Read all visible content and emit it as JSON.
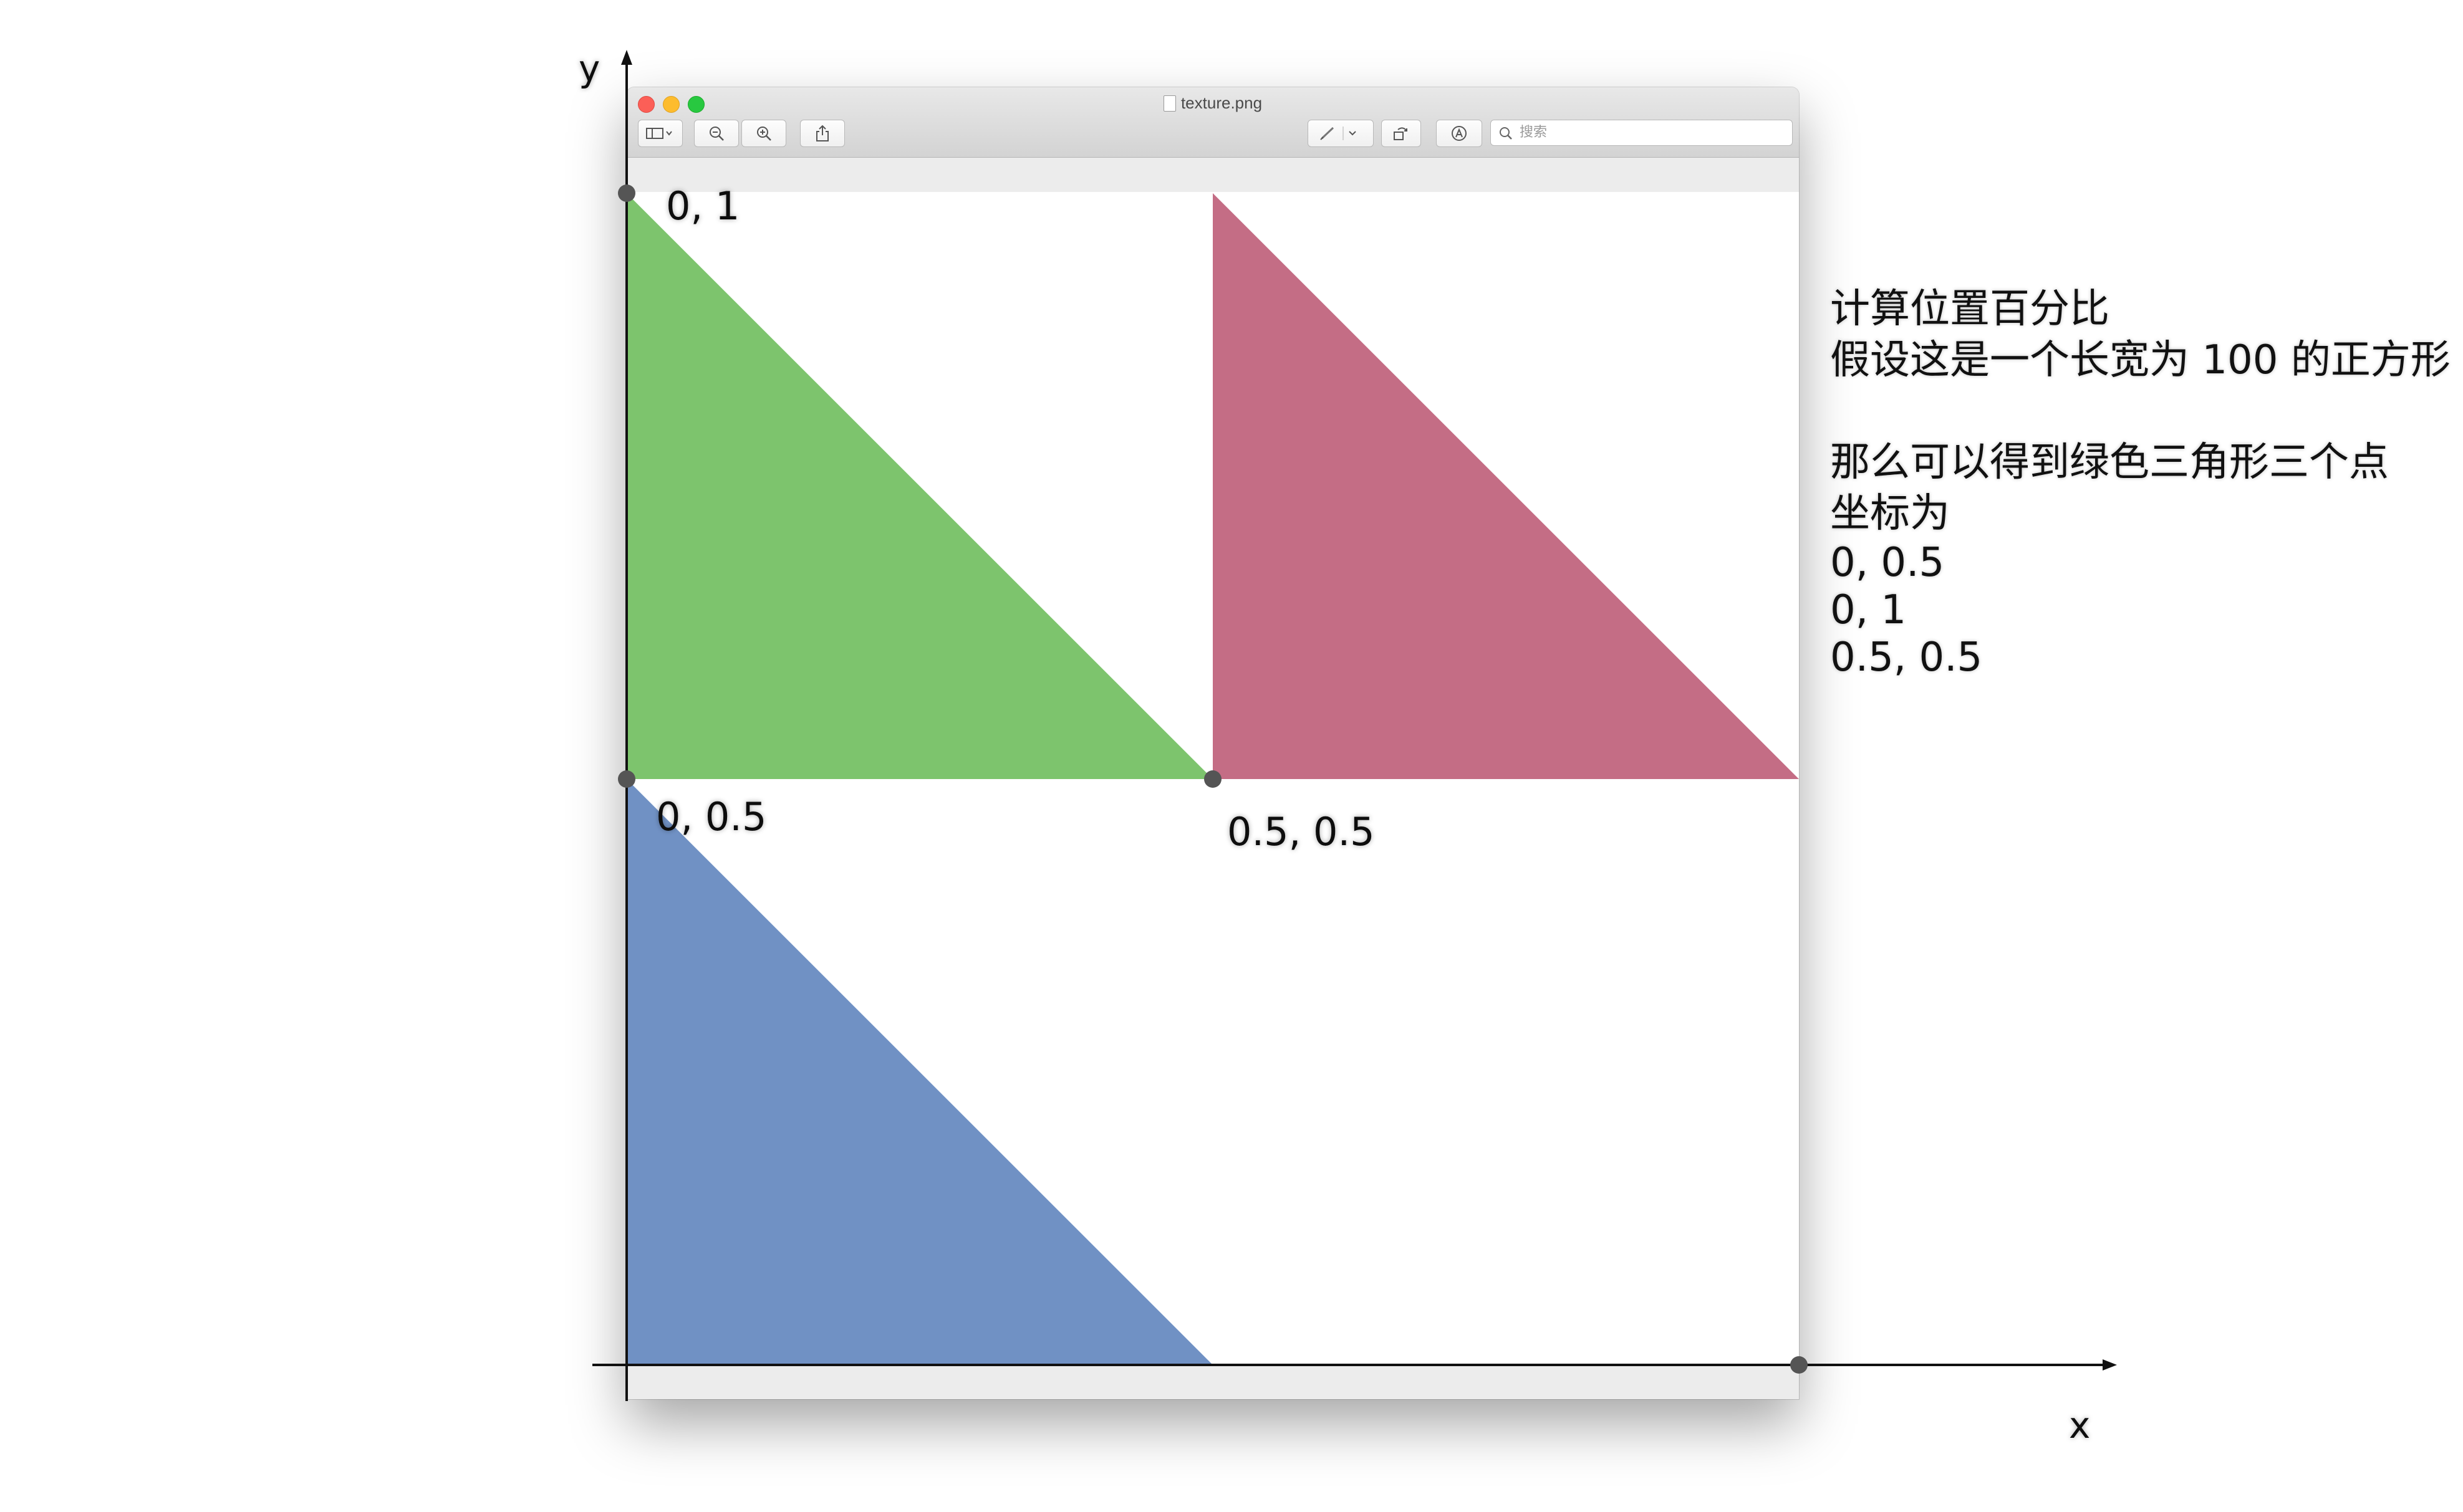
{
  "window": {
    "title": "texture.png",
    "search_placeholder": "搜索",
    "icons": [
      "sidebar-toggle-icon",
      "zoom-out-icon",
      "zoom-in-icon",
      "share-icon",
      "markup-pen-icon",
      "rotate-icon",
      "annotate-icon",
      "search-icon"
    ]
  },
  "axes": {
    "x_label": "x",
    "y_label": "y"
  },
  "point_labels": {
    "top_left": "0, 1",
    "mid_left": "0, 0.5",
    "center": "0.5, 0.5"
  },
  "shapes": [
    {
      "name": "green-triangle",
      "color": "#7dc46d",
      "points": [
        [
          0,
          1
        ],
        [
          0,
          0.5
        ],
        [
          0.5,
          0.5
        ]
      ]
    },
    {
      "name": "red-triangle",
      "color": "#c46d85",
      "points": [
        [
          0.5,
          1
        ],
        [
          0.5,
          0.5
        ],
        [
          1,
          0.5
        ]
      ]
    },
    {
      "name": "blue-triangle",
      "color": "#7091c4",
      "points": [
        [
          0,
          0.5
        ],
        [
          0,
          0
        ],
        [
          0.5,
          0
        ]
      ]
    }
  ],
  "markers": [
    [
      0,
      1
    ],
    [
      0,
      0.5
    ],
    [
      0.5,
      0.5
    ],
    [
      1,
      0
    ]
  ],
  "notes": {
    "line1": "计算位置百分比",
    "line2": "假设这是一个长宽为 100 的正方形",
    "line3": "那么可以得到绿色三角形三个点",
    "line4": "坐标为",
    "coord1": "0, 0.5",
    "coord2": "0, 1",
    "coord3": "0.5, 0.5"
  }
}
